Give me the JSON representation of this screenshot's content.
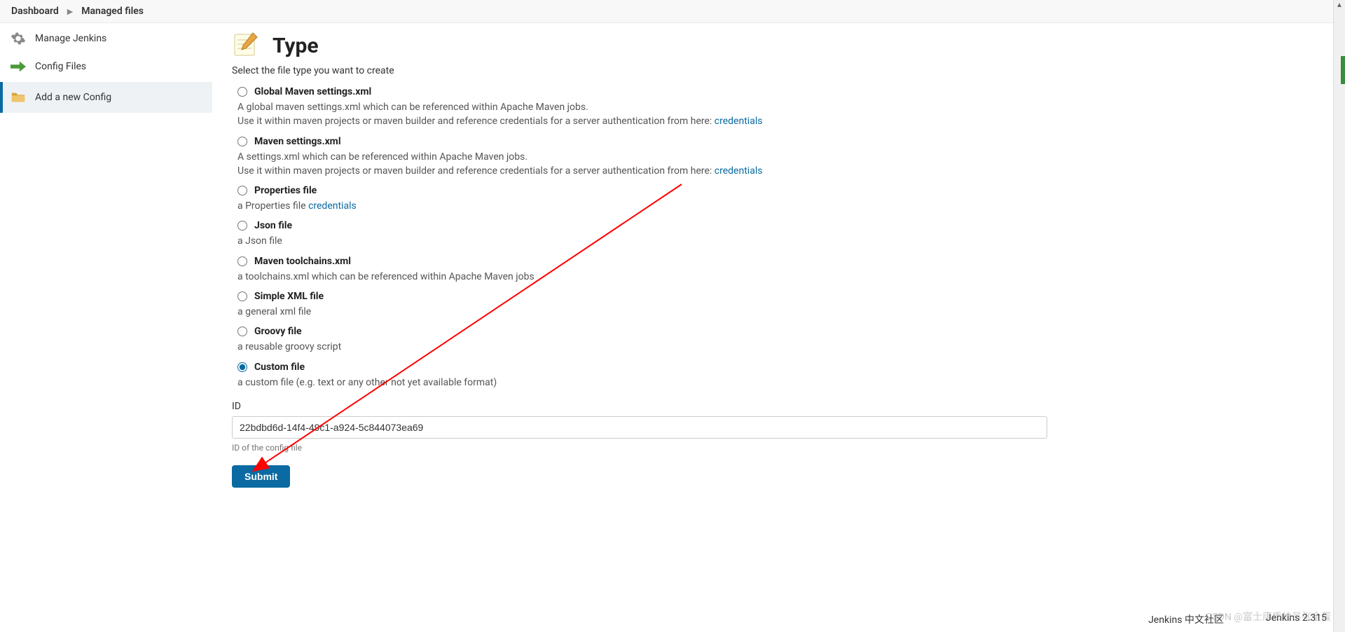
{
  "breadcrumb": {
    "items": [
      "Dashboard",
      "Managed files"
    ]
  },
  "sidebar": {
    "items": [
      {
        "label": "Manage Jenkins",
        "icon": "gear"
      },
      {
        "label": "Config Files",
        "icon": "arrow-right-green"
      },
      {
        "label": "Add a new Config",
        "icon": "folder"
      }
    ]
  },
  "page": {
    "title": "Type",
    "subtitle": "Select the file type you want to create"
  },
  "options": [
    {
      "label": "Global Maven settings.xml",
      "desc_pre": "A global maven settings.xml which can be referenced within Apache Maven jobs.\nUse it within maven projects or maven builder and reference credentials for a server authentication from here: ",
      "link": "credentials"
    },
    {
      "label": "Maven settings.xml",
      "desc_pre": "A settings.xml which can be referenced within Apache Maven jobs.\nUse it within maven projects or maven builder and reference credentials for a server authentication from here: ",
      "link": "credentials"
    },
    {
      "label": "Properties file",
      "desc_pre": "a Properties file ",
      "link": "credentials"
    },
    {
      "label": "Json file",
      "desc_pre": "a Json file",
      "link": ""
    },
    {
      "label": "Maven toolchains.xml",
      "desc_pre": "a toolchains.xml which can be referenced within Apache Maven jobs",
      "link": ""
    },
    {
      "label": "Simple XML file",
      "desc_pre": "a general xml file",
      "link": ""
    },
    {
      "label": "Groovy file",
      "desc_pre": "a reusable groovy script",
      "link": ""
    },
    {
      "label": "Custom file",
      "desc_pre": "a custom file (e.g. text or any other not yet available format)",
      "link": ""
    }
  ],
  "selected_option_index": 7,
  "form": {
    "id_label": "ID",
    "id_value": "22bdbd6d-14f4-49c1-a924-5c844073ea69",
    "id_help": "ID of the config file",
    "submit_label": "Submit"
  },
  "footer": {
    "left": "Jenkins 中文社区",
    "right": "Jenkins 2.315"
  },
  "watermark": "CSDN @富士康质检员张全蛋"
}
